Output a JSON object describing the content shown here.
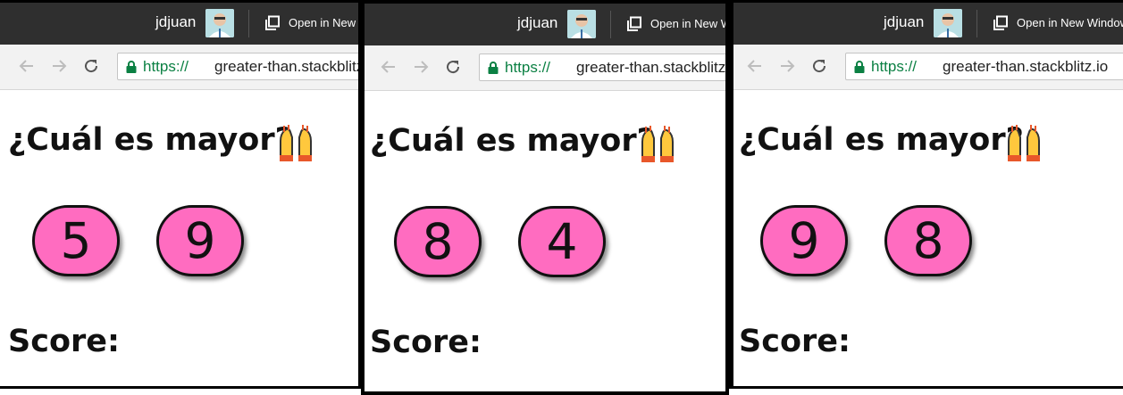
{
  "titlebar": {
    "user": "jdjuan",
    "open_new_window": "Open in New Window"
  },
  "browser": {
    "url_scheme": "https://",
    "url_host": "greater-than.stackblitz.io"
  },
  "app": {
    "question": "¿Cuál es mayor?",
    "question_emoji": "raising-hands-icon",
    "score_label": "Score:"
  },
  "panels": [
    {
      "numbers": [
        "5",
        "9"
      ]
    },
    {
      "numbers": [
        "8",
        "4"
      ]
    },
    {
      "numbers": [
        "9",
        "8"
      ]
    }
  ],
  "colors": {
    "button_fill": "#ff6cc0",
    "titlebar": "#2f2f2f",
    "secure_green": "#0b8043"
  }
}
